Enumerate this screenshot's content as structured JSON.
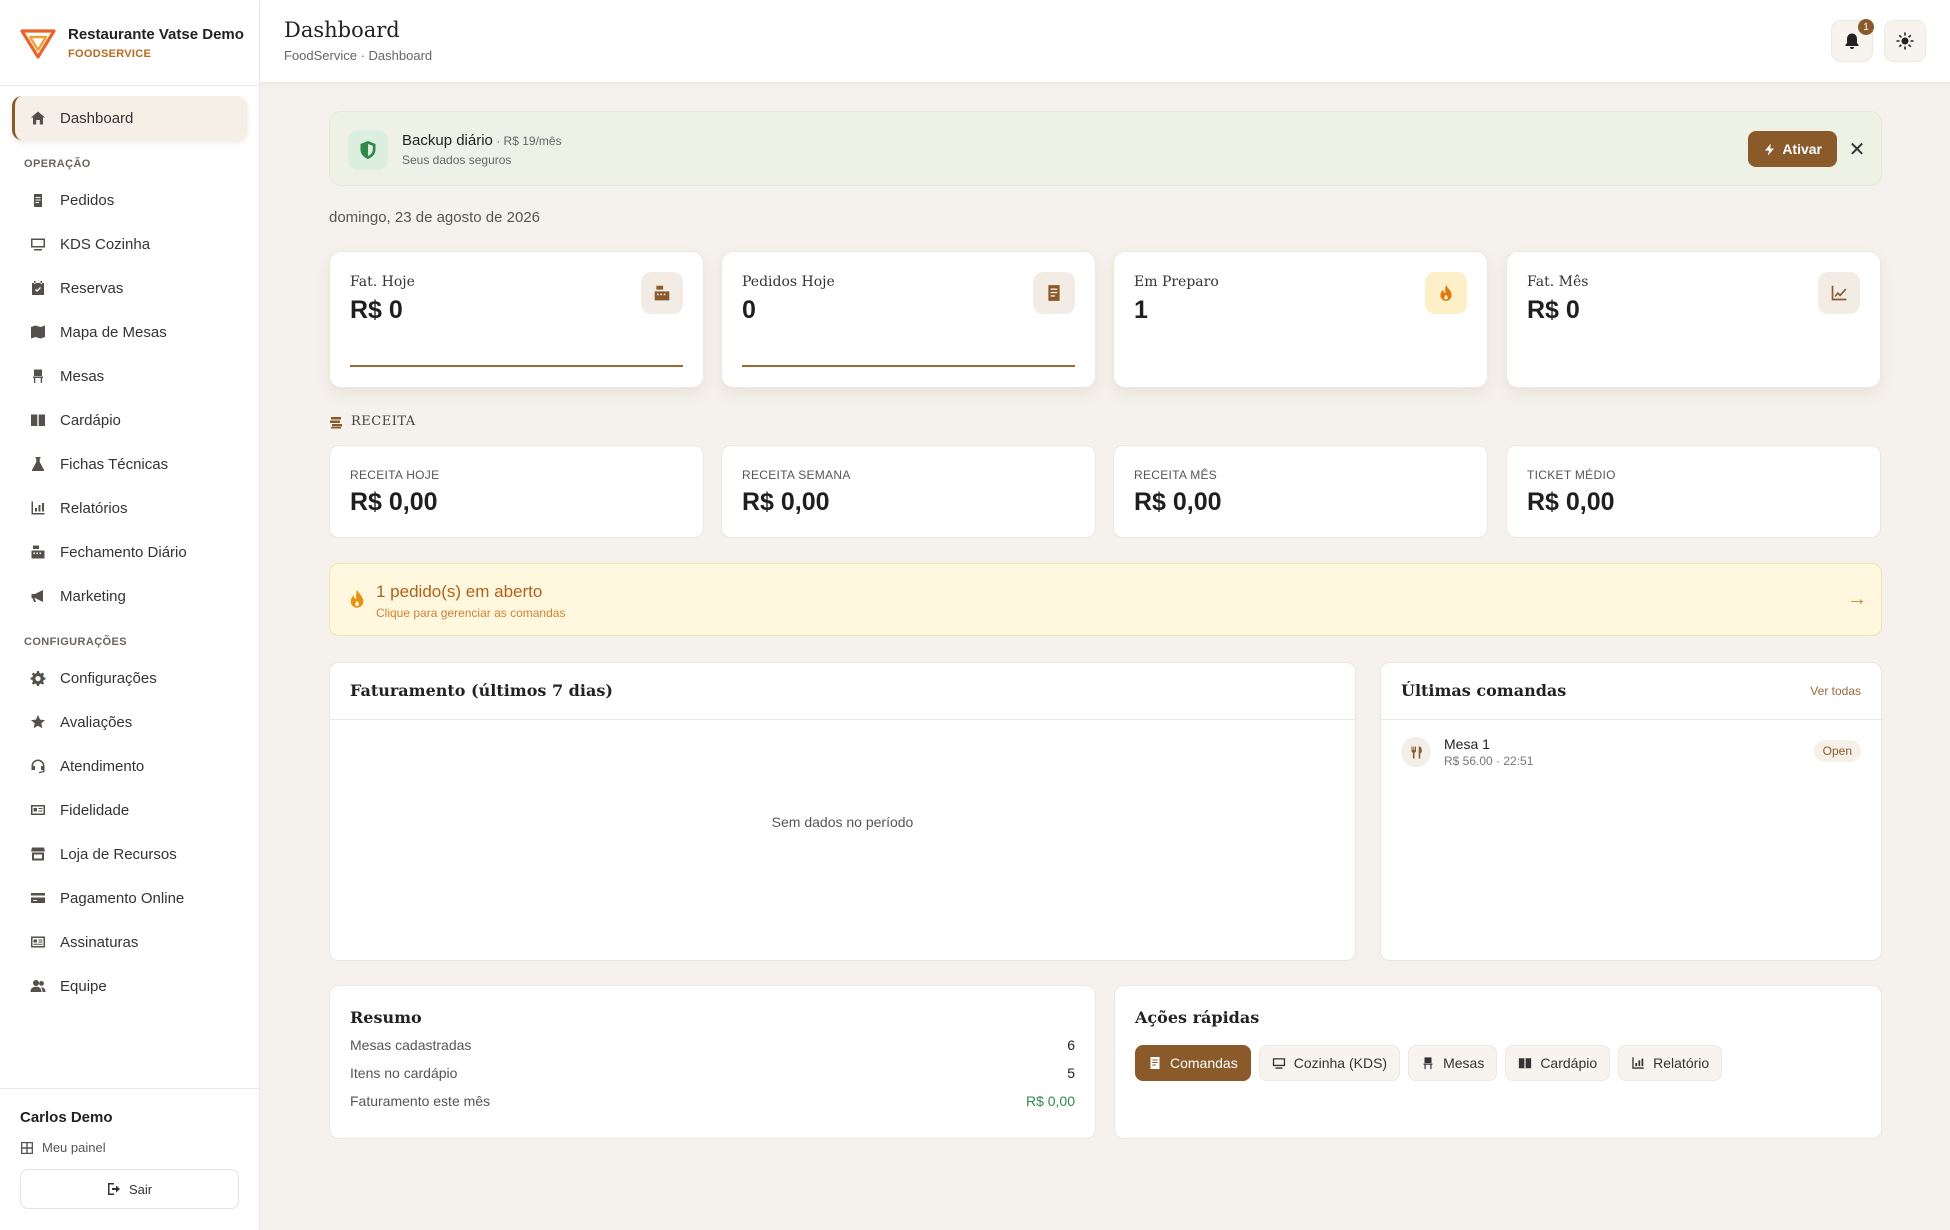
{
  "brand": {
    "name": "Restaurante Vatse Demo",
    "subtitle": "FOODSERVICE",
    "accent": "#8a5a2b"
  },
  "sidebar": {
    "active": {
      "label": "Dashboard",
      "icon": "home-icon"
    },
    "section_ops": "OPERAÇÃO",
    "ops_items": [
      {
        "label": "Pedidos",
        "icon": "clipboard-icon"
      },
      {
        "label": "KDS Cozinha",
        "icon": "monitor-icon"
      },
      {
        "label": "Reservas",
        "icon": "calendar-check-icon"
      },
      {
        "label": "Mapa de Mesas",
        "icon": "map-icon"
      },
      {
        "label": "Mesas",
        "icon": "chair-icon"
      },
      {
        "label": "Cardápio",
        "icon": "book-icon"
      },
      {
        "label": "Fichas Técnicas",
        "icon": "flask-icon"
      },
      {
        "label": "Relatórios",
        "icon": "bar-chart-icon"
      },
      {
        "label": "Fechamento Diário",
        "icon": "cash-register-icon"
      },
      {
        "label": "Marketing",
        "icon": "megaphone-icon"
      }
    ],
    "section_config": "CONFIGURAÇÕES",
    "config_items": [
      {
        "label": "Configurações",
        "icon": "gear-icon"
      },
      {
        "label": "Avaliações",
        "icon": "star-icon"
      },
      {
        "label": "Atendimento",
        "icon": "headset-icon"
      },
      {
        "label": "Fidelidade",
        "icon": "id-card-icon"
      },
      {
        "label": "Loja de Recursos",
        "icon": "store-icon"
      },
      {
        "label": "Pagamento Online",
        "icon": "credit-card-icon"
      },
      {
        "label": "Assinaturas",
        "icon": "subscription-icon"
      },
      {
        "label": "Equipe",
        "icon": "users-icon"
      }
    ]
  },
  "user": {
    "name": "Carlos Demo",
    "panel_label": "Meu painel",
    "logout_label": "Sair"
  },
  "header": {
    "title": "Dashboard",
    "breadcrumb": "FoodService · Dashboard",
    "notification_count": "1"
  },
  "backup": {
    "title": "Backup diário",
    "price": " · R$ 19/mês",
    "subtitle": "Seus dados seguros",
    "activate_label": "Ativar",
    "close_label": "✕"
  },
  "date": "domingo, 23 de agosto de 2026",
  "kpis": [
    {
      "label": "Fat. Hoje",
      "value": "R$ 0",
      "icon": "cash-register-icon"
    },
    {
      "label": "Pedidos Hoje",
      "value": "0",
      "icon": "receipt-icon"
    },
    {
      "label": "Em Preparo",
      "value": "1",
      "icon": "fire-icon"
    },
    {
      "label": "Fat. Mês",
      "value": "R$ 0",
      "icon": "trend-icon"
    }
  ],
  "revenue": {
    "section_title": "RECEITA",
    "cards": [
      {
        "label": "RECEITA HOJE",
        "value": "R$ 0,00"
      },
      {
        "label": "RECEITA SEMANA",
        "value": "R$ 0,00"
      },
      {
        "label": "RECEITA MÊS",
        "value": "R$ 0,00"
      },
      {
        "label": "TICKET MÉDIO",
        "value": "R$ 0,00"
      }
    ]
  },
  "open_orders": {
    "title": "1 pedido(s) em aberto",
    "subtitle": "Clique para gerenciar as comandas",
    "arrow": "→"
  },
  "chart": {
    "title": "Faturamento (últimos 7 dias)",
    "empty_text": "Sem dados no período"
  },
  "last_orders": {
    "title": "Últimas comandas",
    "see_all": "Ver todas",
    "items": [
      {
        "name": "Mesa 1",
        "meta": "R$ 56.00 · 22:51",
        "status": "Open"
      }
    ]
  },
  "summary": {
    "title": "Resumo",
    "rows": [
      {
        "label": "Mesas cadastradas",
        "value": "6"
      },
      {
        "label": "Itens no cardápio",
        "value": "5"
      },
      {
        "label": "Faturamento este mês",
        "value": "R$ 0,00"
      }
    ]
  },
  "quick_actions": {
    "title": "Ações rápidas",
    "items": [
      {
        "label": "Comandas",
        "icon": "receipt-icon"
      },
      {
        "label": "Cozinha (KDS)",
        "icon": "monitor-icon"
      },
      {
        "label": "Mesas",
        "icon": "chair-icon"
      },
      {
        "label": "Cardápio",
        "icon": "book-icon"
      },
      {
        "label": "Relatório",
        "icon": "bar-chart-icon"
      }
    ]
  }
}
